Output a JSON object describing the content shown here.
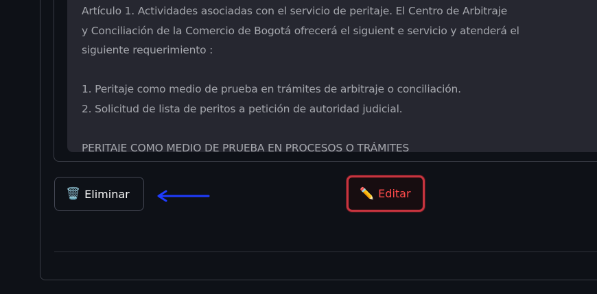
{
  "content": {
    "lines": [
      "Artículo 1. Actividades asociadas con el servicio de peritaje. El Centro de Arbitraje",
      "y Conciliación  de la Comercio  de Bogotá  ofrecerá  el siguient e servicio  y atenderá  el",
      "siguiente  requerimiento :",
      "",
      "1. Peritaje  como  medio de  prueba en  trámites de  arbitraje  o conciliación.",
      "2. Solicitud  de lista de peritos  a petición  de autoridad  judicial.",
      "",
      "PERITAJE COMO MEDIO DE PRUEBA EN PROCESOS O TRÁMITES"
    ]
  },
  "buttons": {
    "delete_label": "Eliminar",
    "delete_icon": "🗑️",
    "edit_label": "Editar",
    "edit_icon": "✏️"
  },
  "colors": {
    "background": "#0e1117",
    "text_area": "#262730",
    "edit_accent": "#ff4b4b",
    "arrow": "#1f3cff"
  }
}
